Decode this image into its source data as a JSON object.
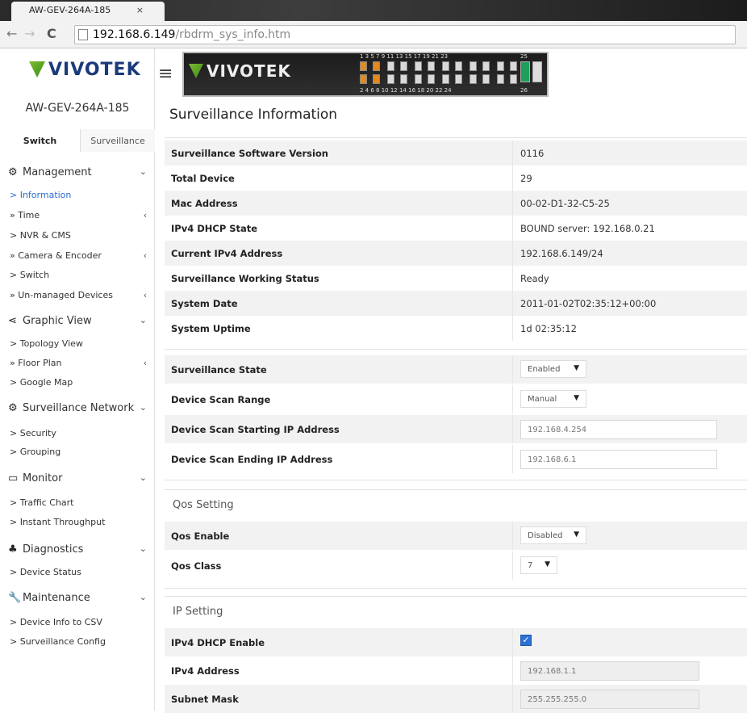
{
  "browser": {
    "tab_title": "AW-GEV-264A-185",
    "tab_close": "×",
    "url_host": "192.168.6.149",
    "url_path": "/rbdrm_sys_info.htm",
    "back_icon": "←",
    "forward_icon": "→",
    "reload_icon": "C"
  },
  "brand": {
    "logo_text": "VIVOTEK",
    "device_name": "AW-GEV-264A-185",
    "accent": "#2a6fd1"
  },
  "sidebar": {
    "tabs": [
      {
        "label": "Switch"
      },
      {
        "label": "Surveillance"
      }
    ],
    "groups": {
      "management": {
        "label": "Management",
        "icon": "gear-icon",
        "chevron": "⌄"
      },
      "graphic": {
        "label": "Graphic View",
        "icon": "share-icon",
        "chevron": "⌄"
      },
      "network": {
        "label": "Surveillance Network",
        "icon": "gears-icon",
        "chevron": "⌄"
      },
      "monitor": {
        "label": "Monitor",
        "icon": "monitor-icon",
        "chevron": "⌄"
      },
      "diagnostics": {
        "label": "Diagnostics",
        "icon": "sitemap-icon",
        "chevron": "⌄"
      },
      "maintenance": {
        "label": "Maintenance",
        "icon": "wrench-icon",
        "chevron": "⌄"
      }
    },
    "items": {
      "information": "> Information",
      "time": "» Time",
      "nvr": "> NVR & CMS",
      "camera": "» Camera & Encoder",
      "switch": "> Switch",
      "unmanaged": "» Un-managed Devices",
      "topology": "> Topology View",
      "floor": "» Floor Plan",
      "google": "> Google Map",
      "security": "> Security",
      "grouping": "> Grouping",
      "traffic": "> Traffic Chart",
      "throughput": "> Instant Throughput",
      "devstatus": "> Device Status",
      "csv": "> Device Info to CSV",
      "config": "> Surveillance Config"
    },
    "submenu_chevron": "‹"
  },
  "panel": {
    "top_ports": "1 3 5 7 9 11 13 15 17 19 21 23",
    "bottom_ports": "2 4 6 8 10 12 14 16 18 20 22 24",
    "sfp_top": "25",
    "sfp_bottom": "26"
  },
  "main": {
    "title": "Surveillance Information",
    "info_rows": [
      {
        "label": "Surveillance Software Version",
        "value": "0116"
      },
      {
        "label": "Total Device",
        "value": "29"
      },
      {
        "label": "Mac Address",
        "value": "00-02-D1-32-C5-25"
      },
      {
        "label": "IPv4 DHCP State",
        "value": "BOUND server: 192.168.0.21"
      },
      {
        "label": "Current IPv4 Address",
        "value": "192.168.6.149/24"
      },
      {
        "label": "Surveillance Working Status",
        "value": "Ready"
      },
      {
        "label": "System Date",
        "value": "2011-01-02T02:35:12+00:00"
      },
      {
        "label": "System Uptime",
        "value": "1d 02:35:12"
      }
    ],
    "surv_state": {
      "label": "Surveillance State",
      "value": "Enabled"
    },
    "scan_range": {
      "label": "Device Scan Range",
      "value": "Manual"
    },
    "scan_start": {
      "label": "Device Scan Starting IP Address",
      "value": "192.168.4.254"
    },
    "scan_end": {
      "label": "Device Scan Ending IP Address",
      "value": "192.168.6.1"
    },
    "qos_title": "Qos Setting",
    "qos_enable": {
      "label": "Qos Enable",
      "value": "Disabled"
    },
    "qos_class": {
      "label": "Qos Class",
      "value": "7"
    },
    "ip_title": "IP Setting",
    "dhcp_enable": {
      "label": "IPv4 DHCP Enable",
      "checked": true,
      "mark": "✓"
    },
    "ipv4": {
      "label": "IPv4 Address",
      "value": "192.168.1.1"
    },
    "subnet": {
      "label": "Subnet Mask",
      "value": "255.255.255.0"
    },
    "caret": "▼"
  }
}
